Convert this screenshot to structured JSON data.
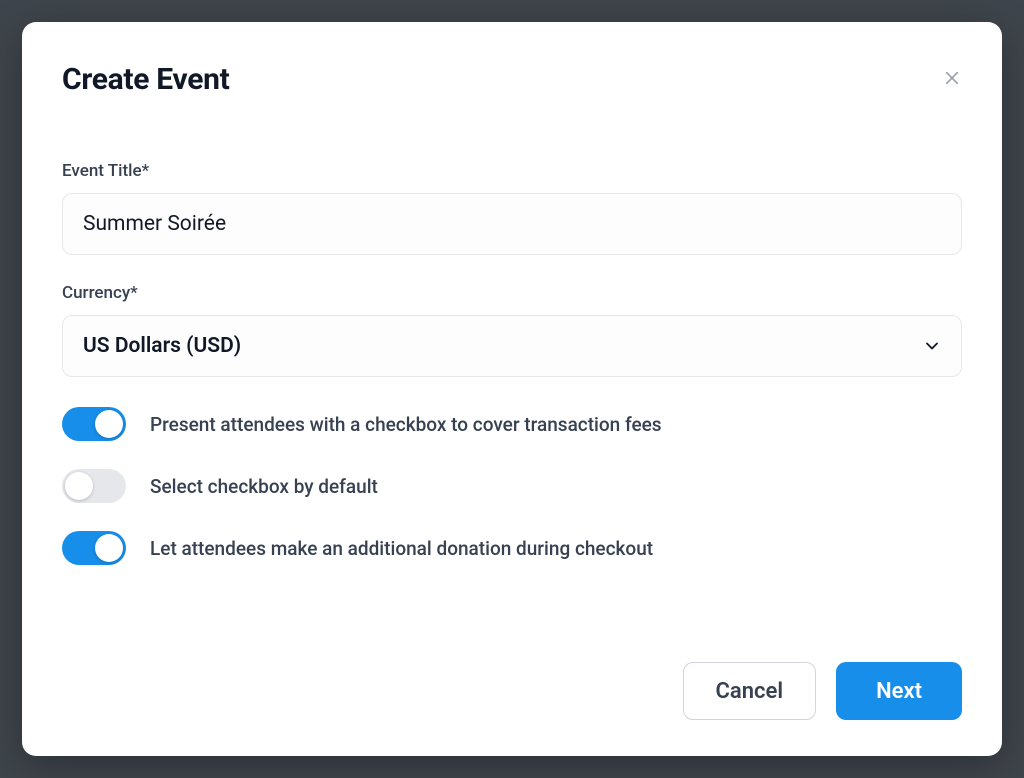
{
  "modal": {
    "title": "Create Event"
  },
  "fields": {
    "event_title": {
      "label": "Event Title*",
      "value": "Summer Soirée"
    },
    "currency": {
      "label": "Currency*",
      "selected": "US Dollars (USD)"
    }
  },
  "toggles": {
    "cover_fees": {
      "label": "Present attendees with a checkbox to cover transaction fees",
      "on": true
    },
    "default_checked": {
      "label": "Select checkbox by default",
      "on": false
    },
    "additional_donation": {
      "label": "Let attendees make an additional donation during checkout",
      "on": true
    }
  },
  "buttons": {
    "cancel": "Cancel",
    "next": "Next"
  }
}
